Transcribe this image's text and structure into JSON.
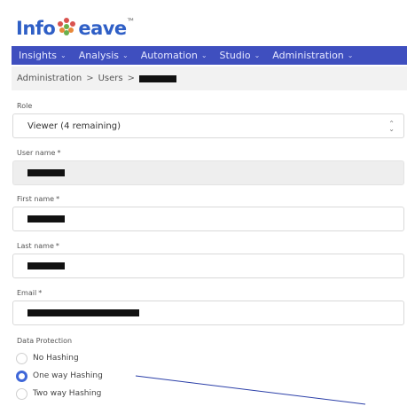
{
  "brand": {
    "logo_text_left": "Info",
    "logo_text_right": "eave",
    "logo_mark": "ᵀᴹ"
  },
  "nav": {
    "items": [
      {
        "label": "Insights",
        "icon": "chevron-down-icon"
      },
      {
        "label": "Analysis",
        "icon": "chevron-down-icon"
      },
      {
        "label": "Automation",
        "icon": "chevron-down-icon"
      },
      {
        "label": "Studio",
        "icon": "chevron-down-icon"
      },
      {
        "label": "Administration",
        "icon": "chevron-down-icon"
      }
    ],
    "chevron": "⌄",
    "bg_color": "#3f4fbf"
  },
  "breadcrumb": {
    "first": "Administration",
    "separator": ">",
    "second": "Users"
  },
  "form": {
    "role": {
      "label": "Role",
      "value": "Viewer (4 remaining)"
    },
    "username": {
      "label": "User name",
      "required": "*"
    },
    "firstname": {
      "label": "First name",
      "required": "*"
    },
    "lastname": {
      "label": "Last name",
      "required": "*"
    },
    "email": {
      "label": "Email",
      "required": "*"
    },
    "data_protection": {
      "label": "Data Protection",
      "options": [
        {
          "label": "No Hashing",
          "checked": false
        },
        {
          "label": "One way Hashing",
          "checked": true
        },
        {
          "label": "Two way Hashing",
          "checked": false
        }
      ]
    }
  },
  "colors": {
    "accent": "#3f67d8",
    "annotation_line": "#2b3fa8"
  }
}
